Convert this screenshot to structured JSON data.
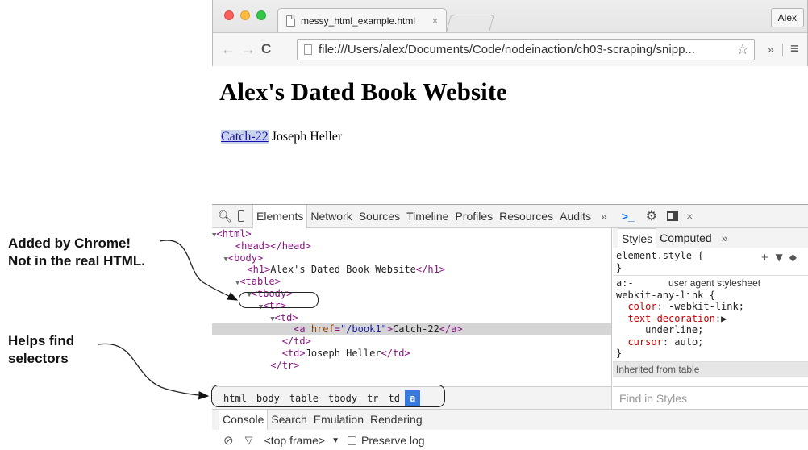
{
  "browser": {
    "tab_title": "messy_html_example.html",
    "tab_close": "×",
    "profile": "Alex",
    "url": "file:///Users/alex/Documents/Code/nodeinaction/ch03-scraping/snipp...",
    "back_icon": "←",
    "forward_icon": "→",
    "reload_icon": "C",
    "star_icon": "☆",
    "more_icon": "»",
    "menu_icon": "≡"
  },
  "page": {
    "heading": "Alex's Dated Book Website",
    "link_text": "Catch-22",
    "author": " Joseph Heller"
  },
  "devtools": {
    "tabs": [
      "Elements",
      "Network",
      "Sources",
      "Timeline",
      "Profiles",
      "Resources",
      "Audits"
    ],
    "active_tab": "Elements",
    "more": "»",
    "console_prompt": ">_",
    "close": "×",
    "dom": [
      {
        "tri": "▼",
        "open": "<html>"
      },
      {
        "indent": 1,
        "open": "<head></head>"
      },
      {
        "tri": "▼",
        "indent": 1,
        "open": "<body>"
      },
      {
        "indent": 2,
        "open": "<h1>",
        "text": "Alex's Dated Book Website",
        "close": "</h1>"
      },
      {
        "tri": "▼",
        "indent": 2,
        "open": "<table>"
      },
      {
        "tri": "▼",
        "indent": 3,
        "open": "<tbody>"
      },
      {
        "tri": "▼",
        "indent": 4,
        "open": "<tr>"
      },
      {
        "tri": "▼",
        "indent": 5,
        "open": "<td>"
      },
      {
        "indent": 6,
        "open": "<a ",
        "attr": "href",
        "value": "\"/book1\"",
        "text": "Catch-22",
        "close": "</a>",
        "selected": true
      },
      {
        "indent": 5,
        "open": "</td>"
      },
      {
        "indent": 5,
        "open": "<td>",
        "text": "Joseph Heller",
        "close": "</td>"
      },
      {
        "indent": 4,
        "open": "</tr>"
      }
    ],
    "styles_tabs": [
      "Styles",
      "Computed"
    ],
    "styles_more": "»",
    "element_style": "element.style {",
    "element_style_close": "}",
    "ua_selector": "a:-",
    "ua_label": "user agent stylesheet",
    "ua_selector_2": "webkit-any-link {",
    "ua_props": [
      {
        "name": "color",
        "value": " -webkit-link;"
      },
      {
        "name": "text-decoration",
        "value": "▶"
      },
      {
        "name": "",
        "value": "underline;"
      },
      {
        "name": "cursor",
        "value": " auto;"
      }
    ],
    "ua_close": "}",
    "inherited": "Inherited from table",
    "breadcrumbs": [
      "html",
      "body",
      "table",
      "tbody",
      "tr",
      "td",
      "a"
    ],
    "find_placeholder": "Find in Styles",
    "drawer_tabs": [
      "Console",
      "Search",
      "Emulation",
      "Rendering"
    ],
    "console_frame": "<top frame>",
    "preserve_log": "Preserve log"
  },
  "annotations": {
    "chrome_added": [
      "Added by Chrome!",
      "Not in the real HTML."
    ],
    "selectors": [
      "Helps find",
      "selectors"
    ]
  }
}
